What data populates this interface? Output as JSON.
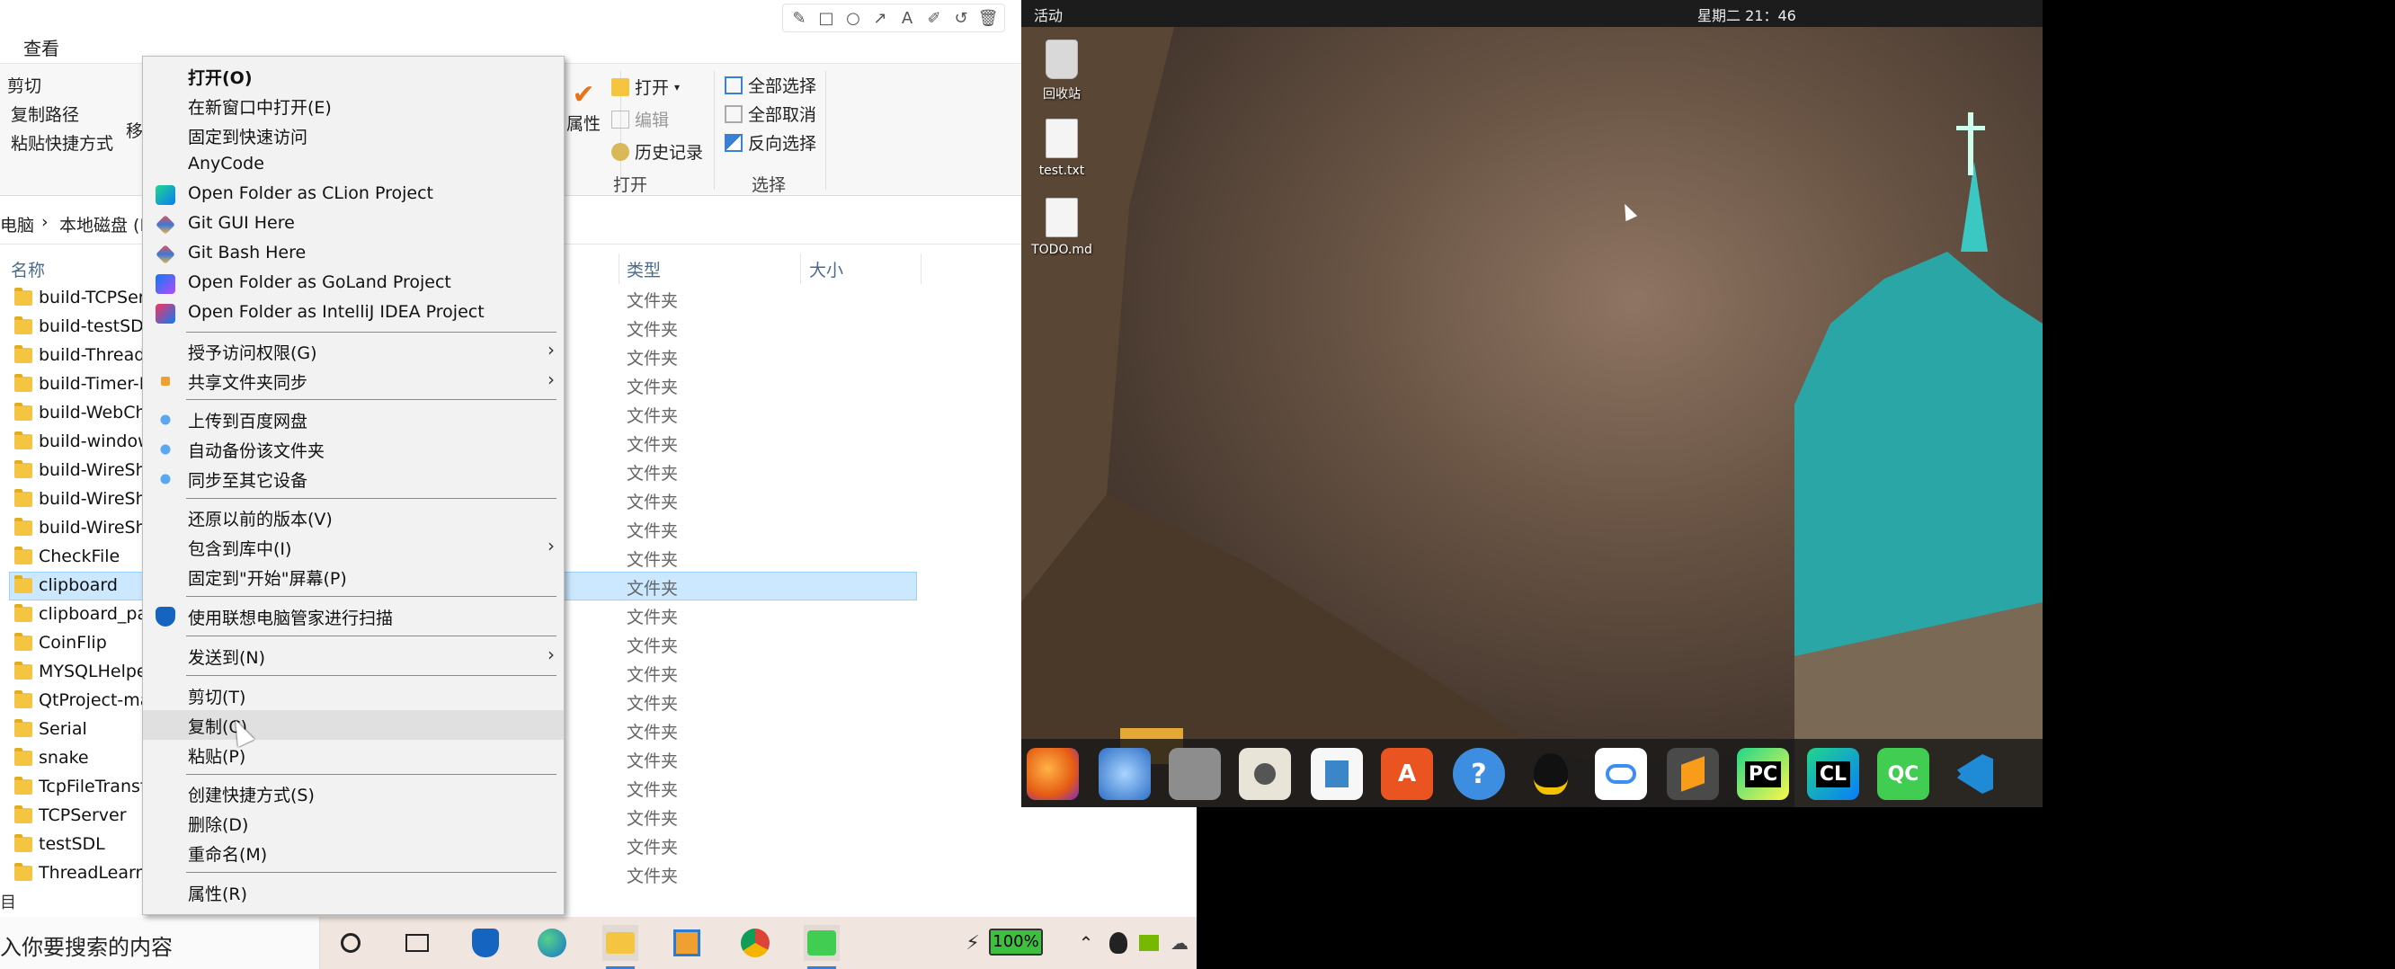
{
  "explorer": {
    "tab_view": "查看",
    "ribbon": {
      "cut": "剪切",
      "copy_path": "复制路径",
      "paste_shortcut": "粘贴快捷方式",
      "move_partial": "移",
      "properties": "属性",
      "open": "打开",
      "edit": "编辑",
      "history": "历史记录",
      "select_all": "全部选择",
      "select_none": "全部取消",
      "invert_select": "反向选择",
      "group_open": "打开",
      "group_select": "选择"
    },
    "breadcrumb": {
      "pc": "电脑",
      "sep": "›",
      "drive": "本地磁盘 (F"
    },
    "columns": {
      "name": "名称",
      "type": "类型",
      "size": "大小"
    },
    "files": [
      {
        "name": "build-TCPServer",
        "type": "文件夹"
      },
      {
        "name": "build-testSDL",
        "type": "文件夹"
      },
      {
        "name": "build-Thread",
        "type": "文件夹"
      },
      {
        "name": "build-Timer-I",
        "type": "文件夹"
      },
      {
        "name": "build-WebCh",
        "type": "文件夹"
      },
      {
        "name": "build-window",
        "type": "文件夹"
      },
      {
        "name": "build-WireSh",
        "type": "文件夹"
      },
      {
        "name": "build-WireSh",
        "type": "文件夹"
      },
      {
        "name": "build-WireSh",
        "type": "文件夹"
      },
      {
        "name": "CheckFile",
        "type": "文件夹"
      },
      {
        "name": "clipboard",
        "type": "文件夹"
      },
      {
        "name": "clipboard_pa",
        "type": "文件夹"
      },
      {
        "name": "CoinFlip",
        "type": "文件夹"
      },
      {
        "name": "MYSQLHelpe",
        "type": "文件夹"
      },
      {
        "name": "QtProject-ma",
        "type": "文件夹"
      },
      {
        "name": "Serial",
        "type": "文件夹"
      },
      {
        "name": "snake",
        "type": "文件夹"
      },
      {
        "name": "TcpFileTransf",
        "type": "文件夹"
      },
      {
        "name": "TCPServer",
        "type": "文件夹"
      },
      {
        "name": "testSDL",
        "type": "文件夹"
      },
      {
        "name": "ThreadLearn",
        "type": "文件夹"
      }
    ],
    "status_left": "目"
  },
  "context_menu": {
    "items": [
      {
        "label": "打开(O)"
      },
      {
        "label": "在新窗口中打开(E)"
      },
      {
        "label": "固定到快速访问"
      },
      {
        "label": "AnyCode"
      },
      {
        "label": "Open Folder as CLion Project"
      },
      {
        "label": "Git GUI Here"
      },
      {
        "label": "Git Bash Here"
      },
      {
        "label": "Open Folder as GoLand Project"
      },
      {
        "label": "Open Folder as IntelliJ IDEA Project"
      },
      {
        "label": "授予访问权限(G)"
      },
      {
        "label": "共享文件夹同步"
      },
      {
        "label": "上传到百度网盘"
      },
      {
        "label": "自动备份该文件夹"
      },
      {
        "label": "同步至其它设备"
      },
      {
        "label": "还原以前的版本(V)"
      },
      {
        "label": "包含到库中(I)"
      },
      {
        "label": "固定到\"开始\"屏幕(P)"
      },
      {
        "label": "使用联想电脑管家进行扫描"
      },
      {
        "label": "发送到(N)"
      },
      {
        "label": "剪切(T)"
      },
      {
        "label": "复制(C)"
      },
      {
        "label": "粘贴(P)"
      },
      {
        "label": "创建快捷方式(S)"
      },
      {
        "label": "删除(D)"
      },
      {
        "label": "重命名(M)"
      },
      {
        "label": "属性(R)"
      }
    ]
  },
  "taskbar": {
    "search_placeholder": "入你要搜索的内容",
    "battery_percent": 100,
    "battery_label": "100%"
  },
  "ubuntu": {
    "activities": "活动",
    "clock": "星期二 21：46",
    "desktop_icons": [
      {
        "label": "回收站"
      },
      {
        "label": "test.txt"
      },
      {
        "label": "TODO.md"
      }
    ],
    "dock_labels": {
      "pycharm": "PC",
      "clion": "CL",
      "qtcreator": "QC"
    }
  },
  "colors": {
    "selection": "#cce8ff",
    "menu_bg": "#f2f2f2",
    "taskbar_bg": "#f0e6df",
    "ubuntu_topbar": "#1c1c1c"
  }
}
